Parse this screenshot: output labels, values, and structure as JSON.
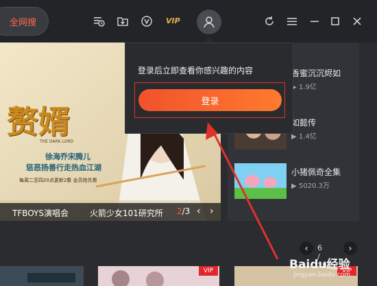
{
  "topbar": {
    "search_tab_label": "全网搜",
    "vip_label": "VIP",
    "icons": [
      "history-icon",
      "download-icon",
      "v-badge-icon",
      "avatar-icon",
      "refresh-icon",
      "menu-icon",
      "minimize-icon",
      "maximize-icon",
      "close-icon"
    ]
  },
  "banner": {
    "poster_title": "赘婿",
    "poster_subtitle": "THE DARK LORD",
    "poster_tagline_1": "徐海乔宋腾儿",
    "poster_tagline_2": "惩恶扬善行走热血江湖",
    "poster_date": "每周二至四20点更新2集 会员抢先看",
    "captions": [
      "TFBOYS演唱会",
      "火箭少女101研究所"
    ],
    "pager_current": "2",
    "pager_total": "/3"
  },
  "side_list": {
    "items": [
      {
        "title": "香蜜沉沉烬如",
        "count": "1.9亿",
        "icon": "play-count-icon"
      },
      {
        "title": "如懿传",
        "count": "1.4亿",
        "icon": "play-count-icon"
      },
      {
        "title": "小猪佩奇全集",
        "count": "5020.3万",
        "icon": "play-count-icon"
      }
    ]
  },
  "popover": {
    "message": "登录后立即查看你感兴趣的内容",
    "login_label": "登录"
  },
  "pager2": {
    "current": "6",
    "total": "18"
  },
  "bottom_row": {
    "vip_badge": "VIP"
  },
  "watermark": {
    "text": "Baidu经验",
    "sub": "jingyan.baidu.com"
  },
  "colors": {
    "accent": "#ff5a3c",
    "login_gradient_start": "#f0522c",
    "login_gradient_end": "#ff7a2e",
    "annotation_red": "#e0322a"
  }
}
